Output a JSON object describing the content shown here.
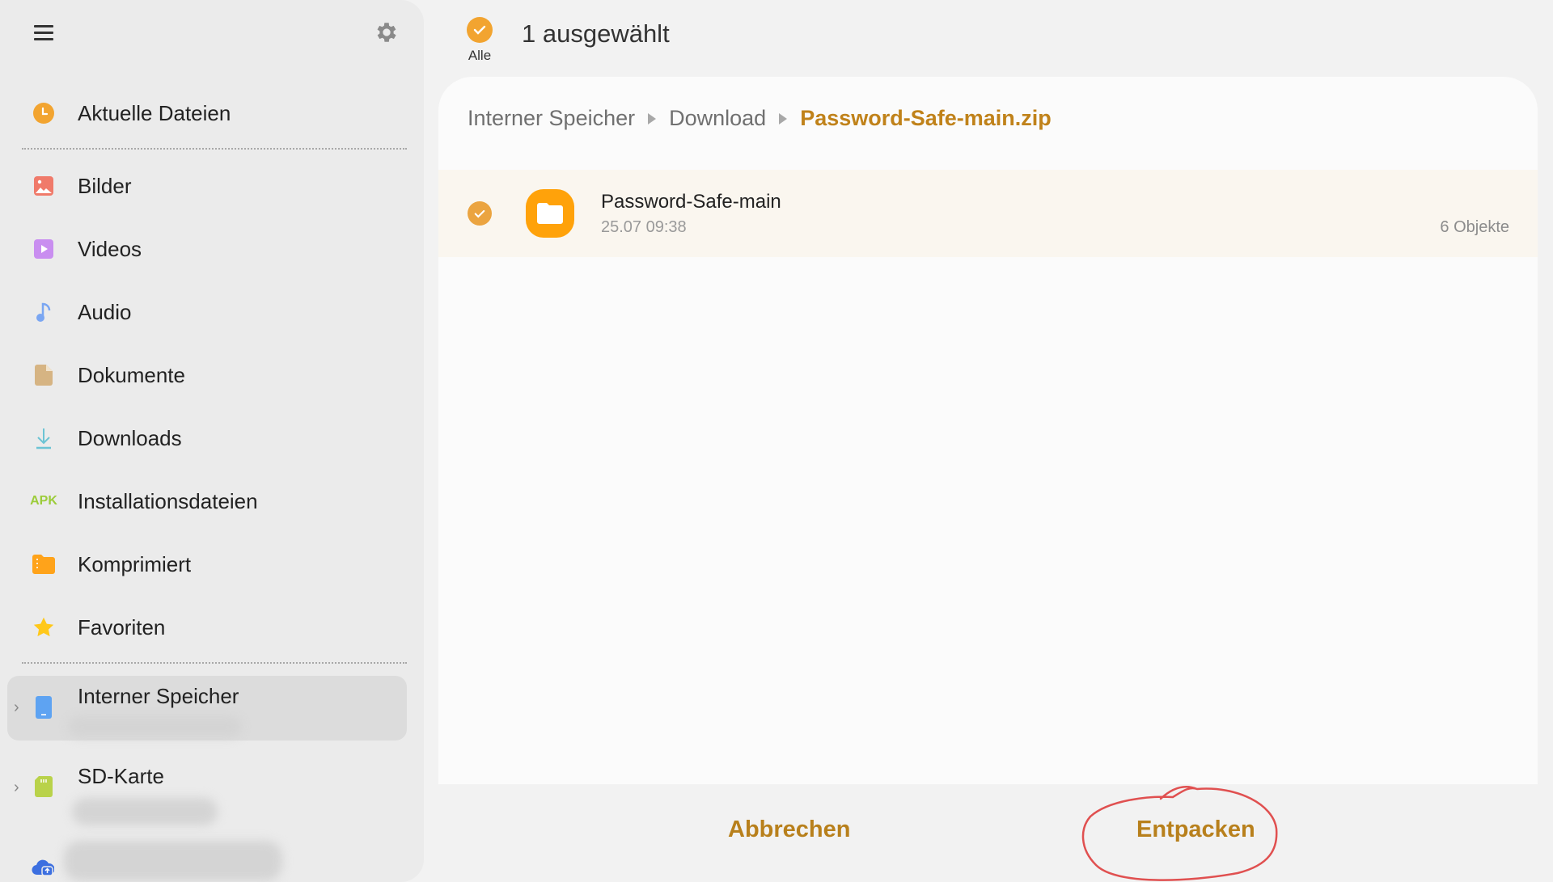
{
  "sidebar": {
    "menu_icon": "hamburger-menu-icon",
    "settings_icon": "gear-icon",
    "categories": [
      {
        "label": "Aktuelle Dateien",
        "icon": "clock-icon",
        "color": "#f2a430"
      },
      {
        "label": "Bilder",
        "icon": "image-icon",
        "color": "#f07a6a"
      },
      {
        "label": "Videos",
        "icon": "video-icon",
        "color": "#c98ef0"
      },
      {
        "label": "Audio",
        "icon": "music-note-icon",
        "color": "#7aa6f2"
      },
      {
        "label": "Dokumente",
        "icon": "document-icon",
        "color": "#d6b483"
      },
      {
        "label": "Downloads",
        "icon": "download-icon",
        "color": "#6cc4d4"
      },
      {
        "label": "Installationsdateien",
        "icon": "apk-icon",
        "icon_text": "APK",
        "color": "#9ccc3a"
      },
      {
        "label": "Komprimiert",
        "icon": "archive-icon",
        "color": "#ffa31a"
      },
      {
        "label": "Favoriten",
        "icon": "star-icon",
        "color": "#ffc81a"
      }
    ],
    "storage": [
      {
        "label": "Interner Speicher",
        "icon": "phone-storage-icon",
        "color": "#5ea3f2",
        "active": true
      },
      {
        "label": "SD-Karte",
        "icon": "sd-card-icon",
        "color": "#b9d24a",
        "active": false
      },
      {
        "label": "",
        "icon": "cloud-upload-icon",
        "color": "#3c6fe0",
        "active": false
      }
    ]
  },
  "topbar": {
    "select_all_label": "Alle",
    "selection_title": "1 ausgewählt"
  },
  "breadcrumb": [
    {
      "label": "Interner Speicher",
      "current": false
    },
    {
      "label": "Download",
      "current": false
    },
    {
      "label": "Password-Safe-main.zip",
      "current": true
    }
  ],
  "files": [
    {
      "name": "Password-Safe-main",
      "date": "25.07 09:38",
      "count": "6 Objekte",
      "type": "folder",
      "selected": true
    }
  ],
  "actions": {
    "cancel": "Abbrechen",
    "extract": "Entpacken"
  },
  "colors": {
    "accent": "#c0821a",
    "check": "#f2a430",
    "folder": "#ffa20a",
    "annotation": "#e05050"
  }
}
